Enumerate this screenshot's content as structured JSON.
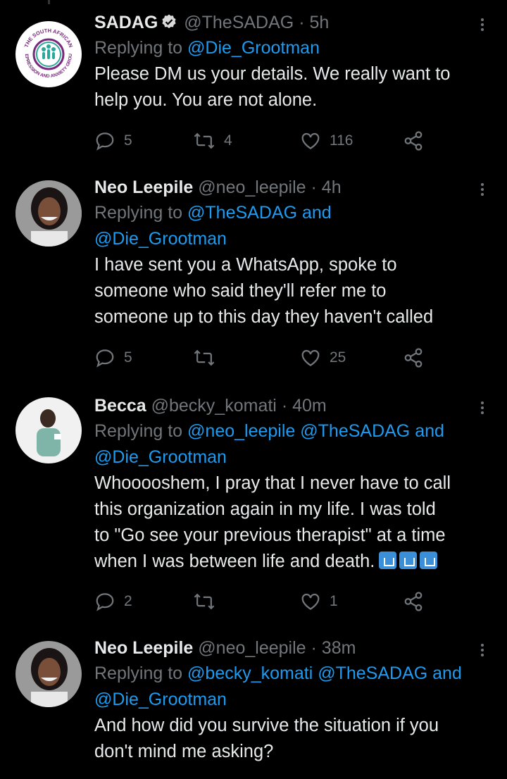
{
  "colors": {
    "background": "#000000",
    "text": "#e7e9ea",
    "muted": "#71767b",
    "link": "#1d9bf0",
    "verified": "#d9d9d9"
  },
  "tweets": [
    {
      "name": "SADAG",
      "verified": true,
      "handle": "@TheSADAG",
      "dot": "·",
      "time": "5h",
      "replying_prefix": "Replying to",
      "replying_to": [
        "@Die_Grootman"
      ],
      "replying_and": "",
      "lines": [
        "Please DM us your details. We really want to",
        "help you. You are not alone."
      ],
      "reply_count": "5",
      "retweet_count": "4",
      "like_count": "116",
      "avatar_lettering": "THE SOUTH AFRICAN DEPRESSION AND ANXIETY GROUP"
    },
    {
      "name": "Neo Leepile",
      "handle": "@neo_leepile",
      "dot": "·",
      "time": "4h",
      "replying_prefix": "Replying to",
      "replying_to": [
        "@TheSADAG",
        "@Die_Grootman"
      ],
      "replying_and": "and",
      "lines": [
        "I have sent you a WhatsApp, spoke to",
        "someone who said they'll refer me to",
        "someone up to this day they haven't called"
      ],
      "reply_count": "5",
      "retweet_count": "",
      "like_count": "25"
    },
    {
      "name": "Becca",
      "handle": "@becky_komati",
      "dot": "·",
      "time": "40m",
      "replying_prefix": "Replying to",
      "replying_to": [
        "@neo_leepile",
        "@TheSADAG",
        "@Die_Grootman"
      ],
      "replying_and": "and",
      "lines": [
        "Whooooshem, I pray that I never have to call",
        "this organization again in my life. I was told",
        "to \"Go see your previous therapist\" at a time",
        "when I was between life and death."
      ],
      "emoji_count": 3,
      "reply_count": "2",
      "retweet_count": "",
      "like_count": "1"
    },
    {
      "name": "Neo Leepile",
      "handle": "@neo_leepile",
      "dot": "·",
      "time": "38m",
      "replying_prefix": "Replying to",
      "replying_to": [
        "@becky_komati",
        "@TheSADAG",
        "@Die_Grootman"
      ],
      "replying_and": "and",
      "lines": [
        "And how did you survive the situation if you",
        "don't mind me asking?"
      ]
    }
  ]
}
